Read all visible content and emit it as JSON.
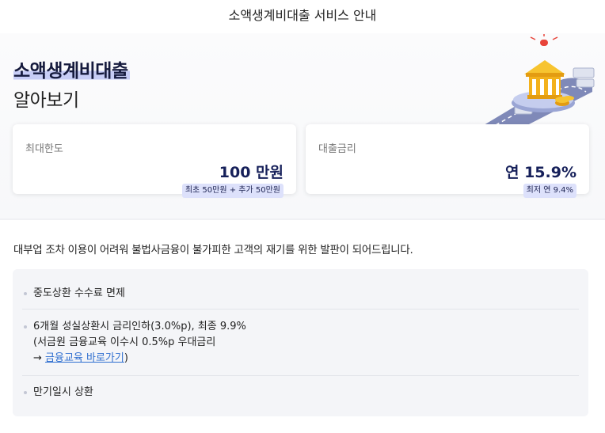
{
  "header": {
    "title": "소액생계비대출 서비스 안내"
  },
  "hero": {
    "title_highlight": "소액생계비대출",
    "title_sub": "알아보기"
  },
  "cards": [
    {
      "label": "최대한도",
      "value": "100 만원",
      "badge": "최초 50만원 + 추가 50만원"
    },
    {
      "label": "대출금리",
      "value": "연 15.9%",
      "badge": "최저 연 9.4%"
    }
  ],
  "intro": "대부업 조차 이용이 어려워 불법사금융이 불가피한 고객의 재기를 위한 발판이 되어드립니다.",
  "benefits": {
    "item1": "중도상환 수수료 면제",
    "item2_line1": "6개월 성실상환시 금리인하(3.0%p), 최종 9.9%",
    "item2_line2": "(서금원 금융교육 이수시 0.5%p 우대금리",
    "item2_arrow": "→ ",
    "item2_link": "금융교육 바로가기",
    "item2_close": ")",
    "item3": "만기일시 상환"
  },
  "colors": {
    "navy": "#16205a",
    "highlight": "#c7cdf6",
    "badge_bg": "#dde1fb",
    "link": "#2f6fd0"
  }
}
